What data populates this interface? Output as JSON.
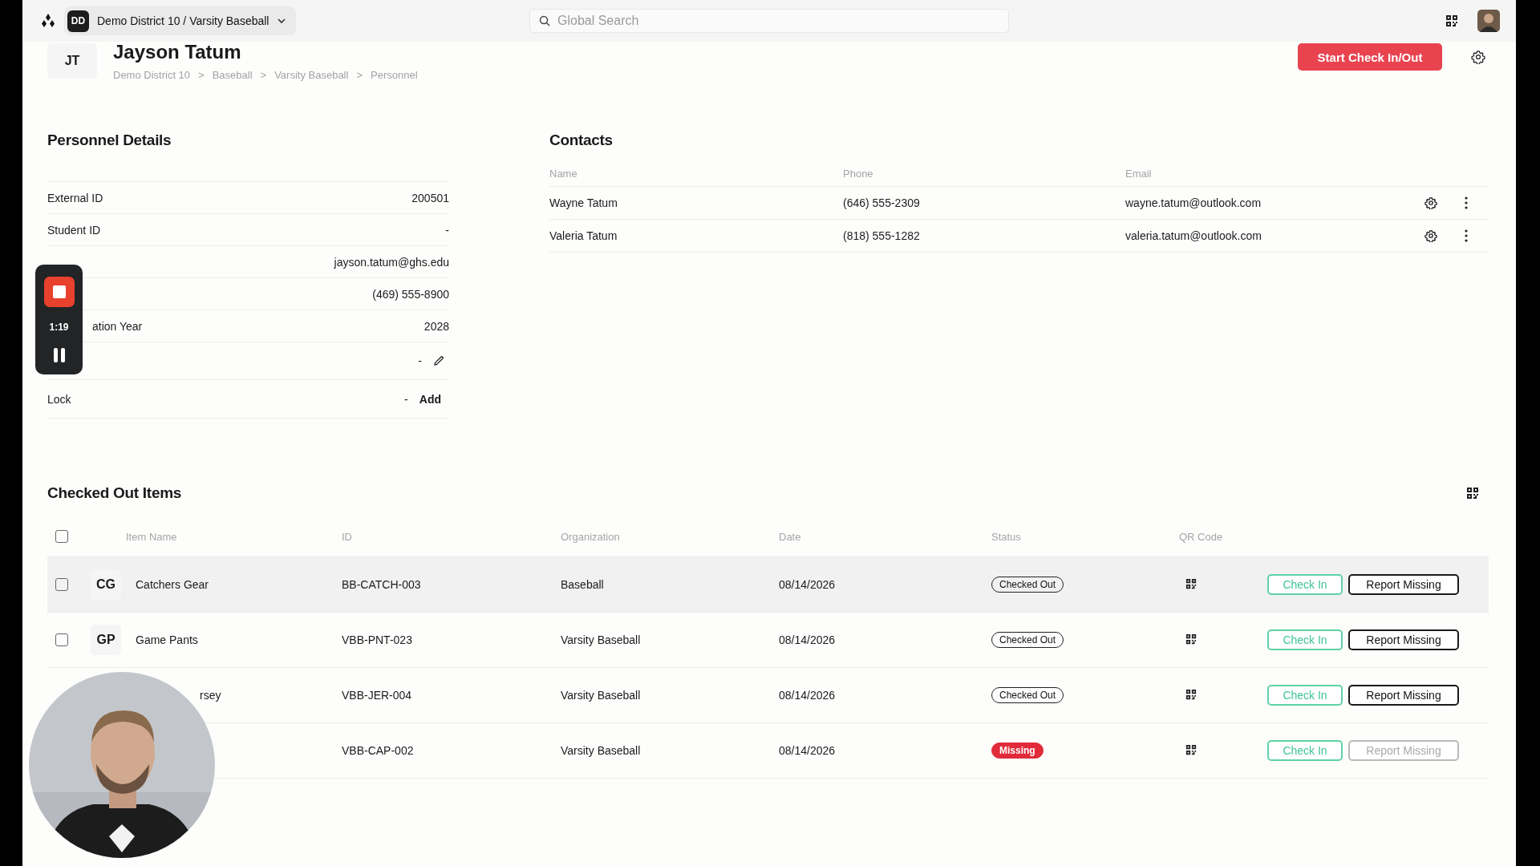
{
  "topbar": {
    "org_initials": "DD",
    "org_name": "Demo District 10 / Varsity Baseball",
    "search": {
      "placeholder": "Global Search"
    }
  },
  "profile": {
    "initials": "JT",
    "name": "Jayson Tatum",
    "breadcrumb": [
      {
        "label": "Demo District 10"
      },
      {
        "label": "Baseball"
      },
      {
        "label": "Varsity Baseball"
      },
      {
        "label": "Personnel"
      }
    ],
    "separators": [
      ">",
      ">",
      ">"
    ]
  },
  "primary_action": "Start Check In/Out",
  "personnel_details": {
    "title": "Personnel Details",
    "rows": [
      {
        "kind": "text",
        "label": "External ID",
        "value": "200501"
      },
      {
        "kind": "text",
        "label": "Student ID",
        "value": "-"
      },
      {
        "kind": "text",
        "value": "jayson.tatum@ghs.edu"
      },
      {
        "kind": "text",
        "value": "(469) 555-8900"
      },
      {
        "kind": "text",
        "label": "ation Year",
        "partial": true,
        "value": "2028"
      },
      {
        "kind": "editable",
        "value": "-"
      },
      {
        "kind": "action",
        "label": "Lock",
        "value": "-",
        "action": "Add"
      }
    ]
  },
  "contacts": {
    "title": "Contacts",
    "columns": [
      "Name",
      "Phone",
      "Email"
    ],
    "rows": [
      {
        "name": "Wayne Tatum",
        "phone": "(646) 555-2309",
        "email": "wayne.tatum@outlook.com"
      },
      {
        "name": "Valeria Tatum",
        "phone": "(818) 555-1282",
        "email": "valeria.tatum@outlook.com"
      }
    ]
  },
  "checked_out": {
    "title": "Checked Out Items",
    "select_all": {
      "checked": false
    },
    "columns": [
      "Item Name",
      "ID",
      "Organization",
      "Date",
      "Status",
      "QR Code"
    ],
    "rows": [
      {
        "checked": false,
        "highlighted": true,
        "initials": "CG",
        "name": "Catchers Gear",
        "id": "BB-CATCH-003",
        "organization": "Baseball",
        "date": "08/14/2026",
        "status": {
          "label": "Checked Out",
          "kind": "outline"
        },
        "check_in": "Check In",
        "report_missing": "Report Missing",
        "report_disabled": false
      },
      {
        "checked": false,
        "initials": "GP",
        "name": "Game Pants",
        "id": "VBB-PNT-023",
        "organization": "Varsity Baseball",
        "date": "08/14/2026",
        "status": {
          "label": "Checked Out",
          "kind": "outline"
        },
        "check_in": "Check In",
        "report_missing": "Report Missing",
        "report_disabled": false
      },
      {
        "name": "rsey",
        "partial": true,
        "id": "VBB-JER-004",
        "organization": "Varsity Baseball",
        "date": "08/14/2026",
        "status": {
          "label": "Checked Out",
          "kind": "outline"
        },
        "check_in": "Check In",
        "report_missing": "Report Missing",
        "report_disabled": false
      },
      {
        "id": "VBB-CAP-002",
        "organization": "Varsity Baseball",
        "date": "08/14/2026",
        "status": {
          "label": "Missing",
          "kind": "alert"
        },
        "check_in": "Check In",
        "report_missing": "Report Missing",
        "report_disabled": true
      }
    ]
  },
  "recorder": {
    "time": "1:19"
  }
}
